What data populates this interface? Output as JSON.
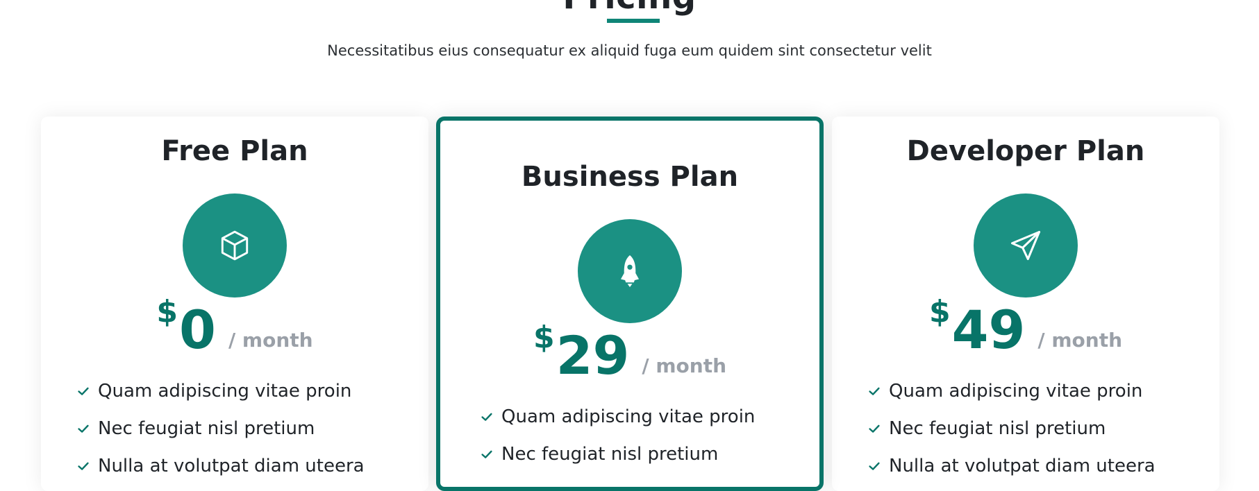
{
  "section": {
    "title": "Pricing",
    "subtitle": "Necessitatibus eius consequatur ex aliquid fuga eum quidem sint consectetur velit"
  },
  "colors": {
    "accent": "#087468",
    "icon_circle": "#1b9183",
    "muted": "#9aa0a8"
  },
  "plans": [
    {
      "name": "Free Plan",
      "icon": "box-icon",
      "currency": "$",
      "amount": "0",
      "period": "/ month",
      "features": [
        "Quam adipiscing vitae proin",
        "Nec feugiat nisl pretium",
        "Nulla at volutpat diam uteera"
      ]
    },
    {
      "name": "Business Plan",
      "icon": "rocket-icon",
      "featured": true,
      "currency": "$",
      "amount": "29",
      "period": "/ month",
      "features": [
        "Quam adipiscing vitae proin",
        "Nec feugiat nisl pretium"
      ]
    },
    {
      "name": "Developer Plan",
      "icon": "send-icon",
      "currency": "$",
      "amount": "49",
      "period": "/ month",
      "features": [
        "Quam adipiscing vitae proin",
        "Nec feugiat nisl pretium",
        "Nulla at volutpat diam uteera"
      ]
    }
  ]
}
